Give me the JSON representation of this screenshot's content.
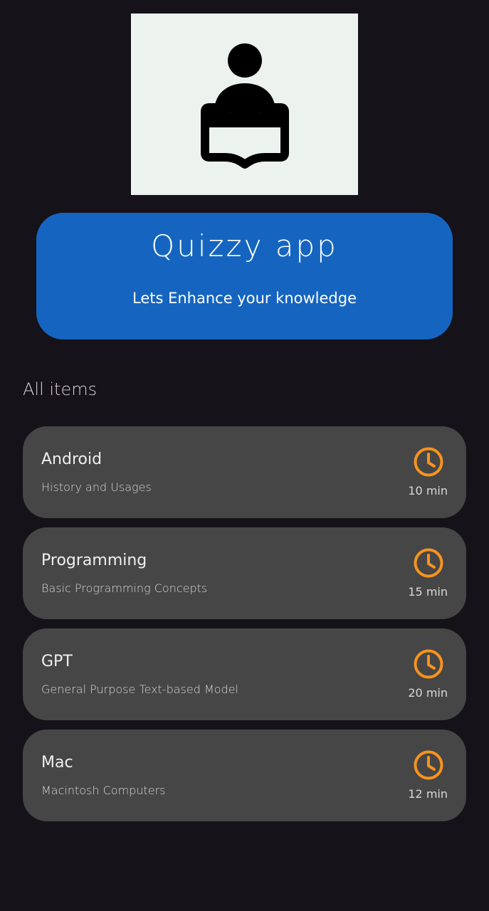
{
  "hero": {
    "title": "Quizzy app",
    "subtitle": "Lets Enhance your knowledge"
  },
  "logo": {
    "icon": "reader-icon",
    "background": "#ecf3ef"
  },
  "section": {
    "title": "All items"
  },
  "colors": {
    "accent": "#1565c0",
    "background": "#151219",
    "card": "#464646",
    "clock": "#f7931e"
  },
  "items": [
    {
      "title": "Android",
      "description": "History and Usages",
      "time": "10 min",
      "icon": "clock-icon"
    },
    {
      "title": "Programming",
      "description": "Basic Programming Concepts",
      "time": "15 min",
      "icon": "clock-icon"
    },
    {
      "title": "GPT",
      "description": "General Purpose Text-based Model",
      "time": "20 min",
      "icon": "clock-icon"
    },
    {
      "title": "Mac",
      "description": "Macintosh Computers",
      "time": "12 min",
      "icon": "clock-icon"
    }
  ]
}
